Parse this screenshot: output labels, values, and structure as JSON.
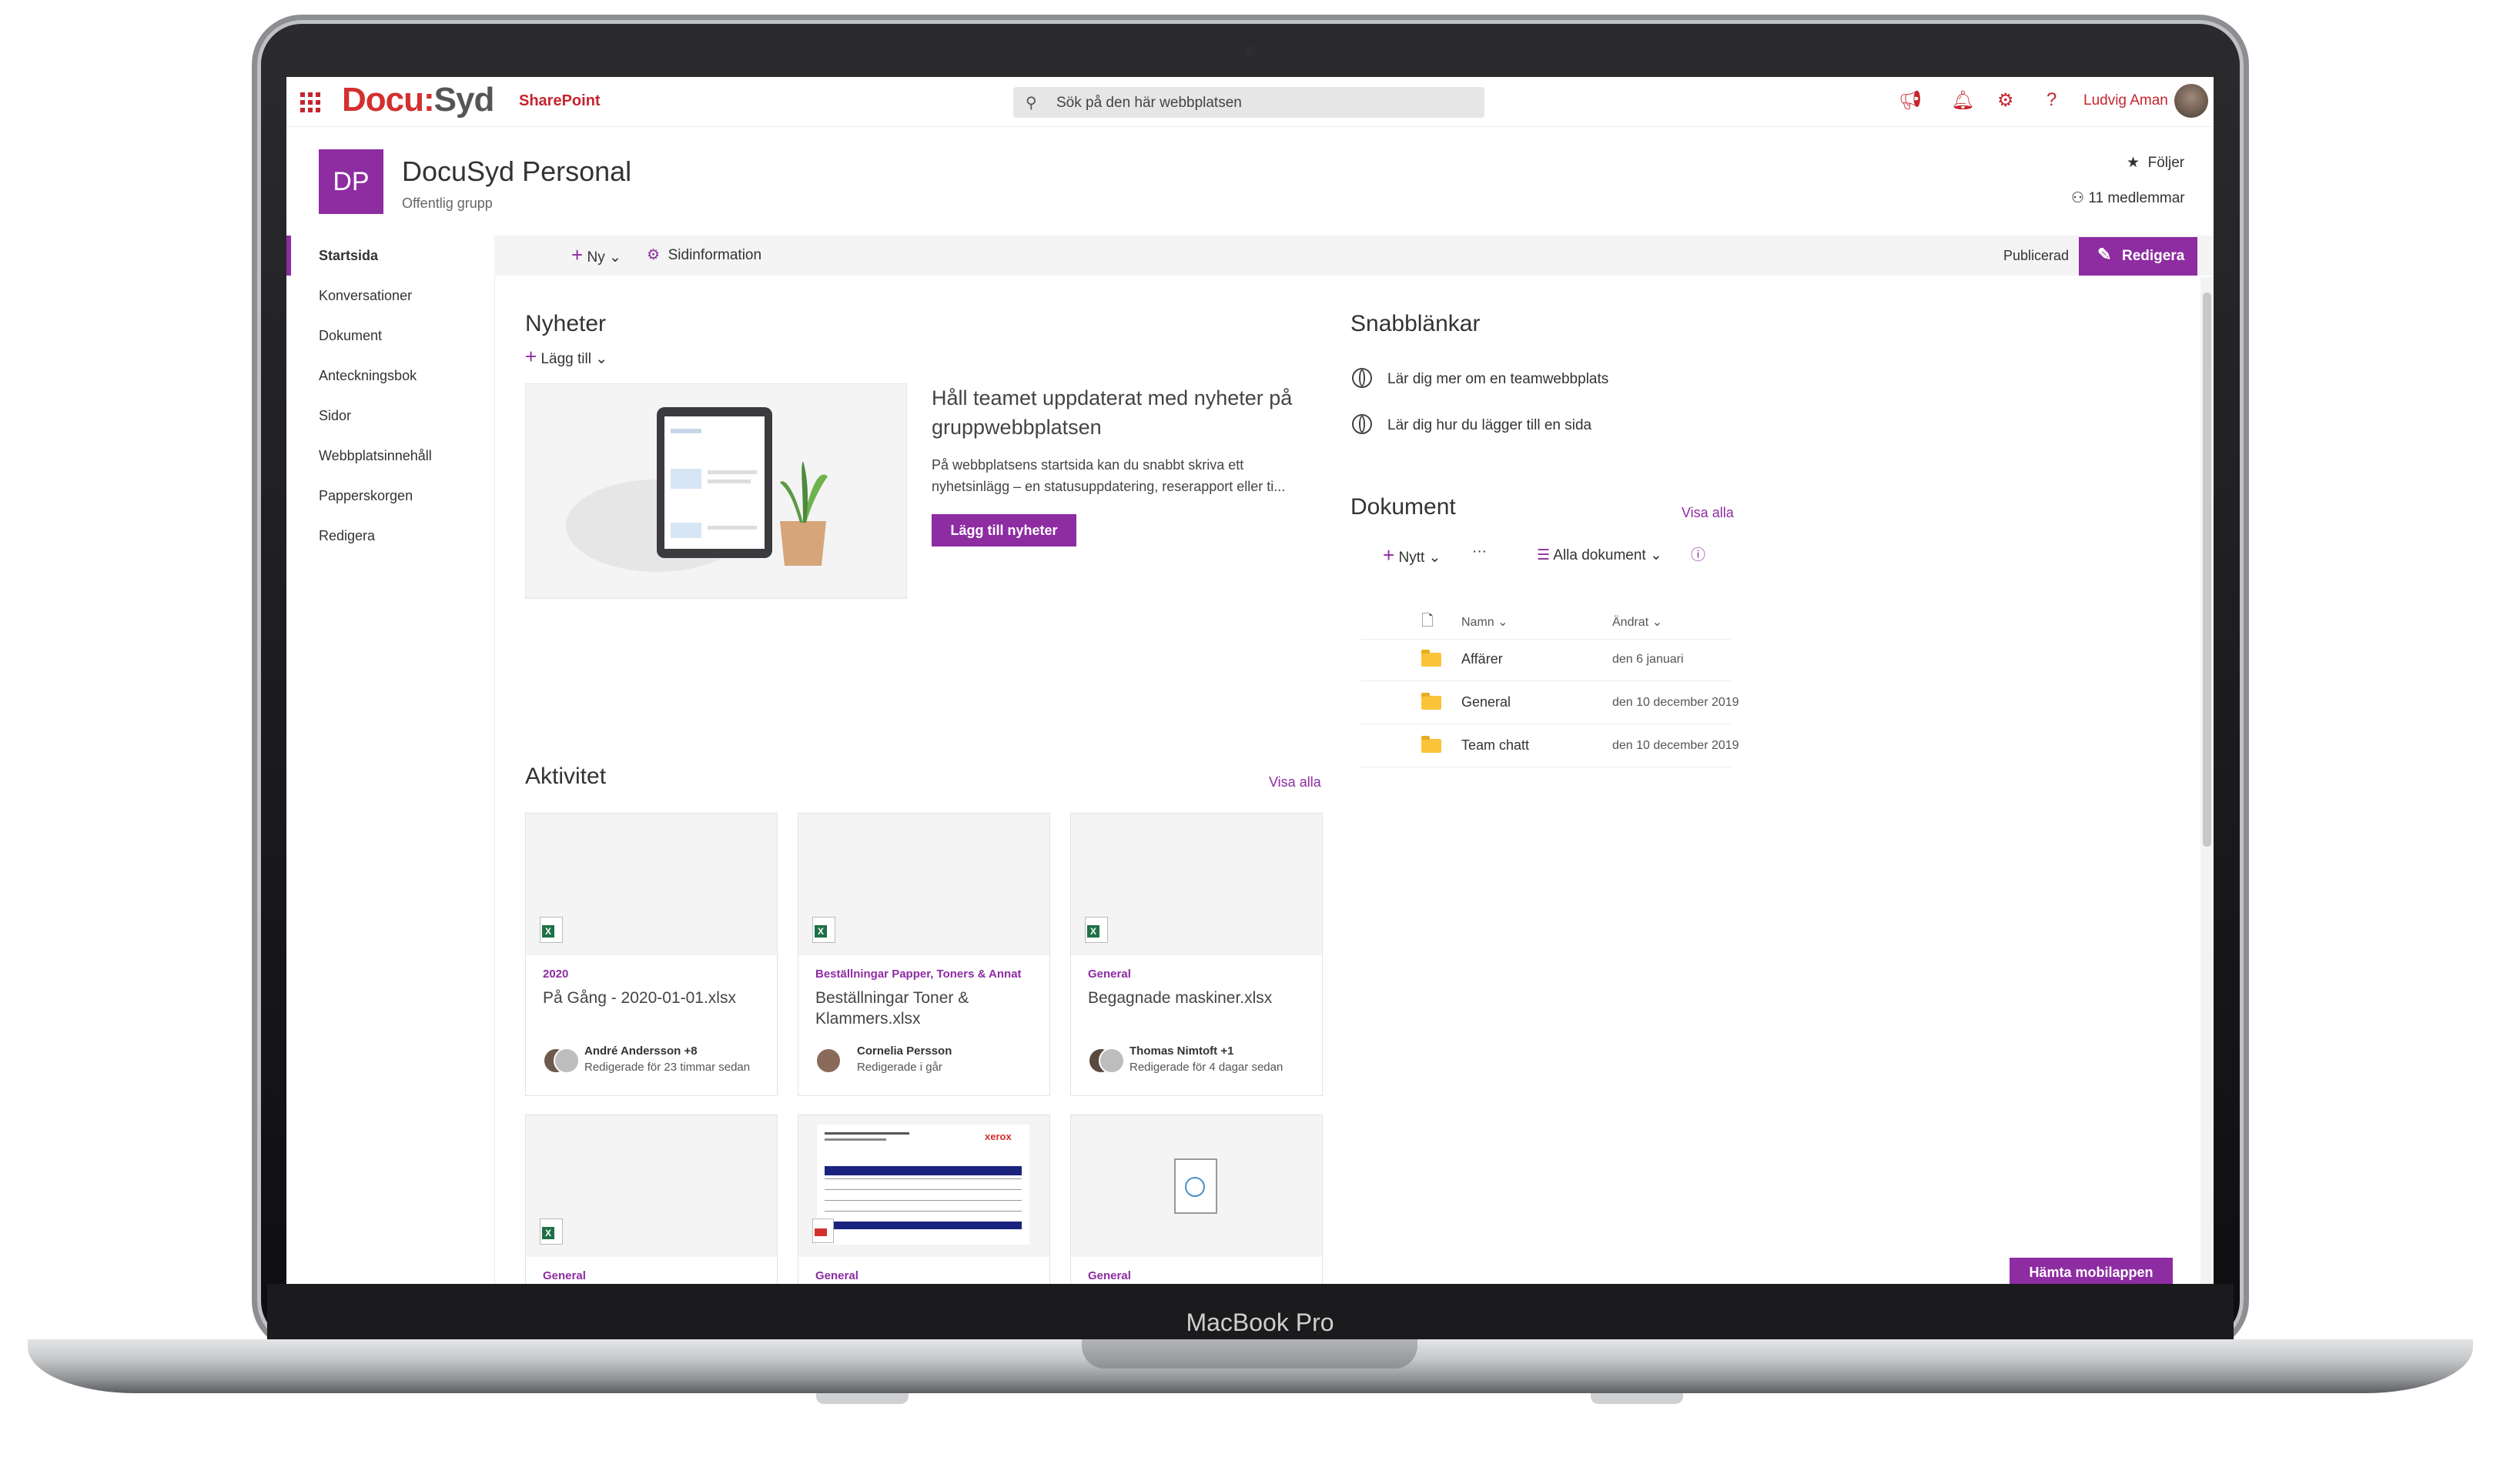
{
  "device": {
    "label": "MacBook Pro"
  },
  "suite": {
    "logo_docu": "Docu",
    "logo_colon": ":",
    "logo_syd": "Syd",
    "app_name": "SharePoint",
    "search_placeholder": "Sök på den här webbplatsen",
    "user_name": "Ludvig Aman"
  },
  "site": {
    "logo_initials": "DP",
    "title": "DocuSyd Personal",
    "subtitle": "Offentlig grupp",
    "follow_label": "Följer",
    "members_label": "11 medlemmar"
  },
  "nav": {
    "items": [
      "Startsida",
      "Konversationer",
      "Dokument",
      "Anteckningsbok",
      "Sidor",
      "Webbplatsinnehåll",
      "Papperskorgen",
      "Redigera"
    ]
  },
  "commandbar": {
    "new_label": "Ny",
    "page_info_label": "Sidinformation",
    "published_label": "Publicerad",
    "edit_label": "Redigera"
  },
  "news": {
    "title": "Nyheter",
    "add_label": "Lägg till",
    "headline": "Håll teamet uppdaterat med nyheter på gruppwebbplatsen",
    "body": "På webbplatsens startsida kan du snabbt skriva ett nyhetsinlägg – en statusuppdatering, reserapport eller ti...",
    "button_label": "Lägg till nyheter"
  },
  "quicklinks": {
    "title": "Snabblänkar",
    "items": [
      "Lär dig mer om en teamwebbplats",
      "Lär dig hur du lägger till en sida"
    ]
  },
  "documents": {
    "title": "Dokument",
    "see_all": "Visa alla",
    "new_label": "Nytt",
    "more_label": "···",
    "view_label": "Alla dokument",
    "col_name": "Namn",
    "col_modified": "Ändrat",
    "rows": [
      {
        "name": "Affärer",
        "date": "den 6 januari"
      },
      {
        "name": "General",
        "date": "den 10 december 2019"
      },
      {
        "name": "Team chatt",
        "date": "den 10 december 2019"
      }
    ]
  },
  "activity": {
    "title": "Aktivitet",
    "see_all": "Visa alla",
    "cards": [
      {
        "site": "2020",
        "title": "På Gång - 2020-01-01.xlsx",
        "author": "André Andersson +8",
        "time": "Redigerade för 23 timmar sedan"
      },
      {
        "site": "Beställningar Papper, Toners & Annat",
        "title": "Beställningar Toner & Klammers.xlsx",
        "author": "Cornelia Persson",
        "time": "Redigerade i går"
      },
      {
        "site": "General",
        "title": "Begagnade maskiner.xlsx",
        "author": "Thomas Nimtoft +1",
        "time": "Redigerade för 4 dagar sedan"
      },
      {
        "site": "General"
      },
      {
        "site": "General",
        "doc_brand": "xerox"
      },
      {
        "site": "General"
      }
    ]
  },
  "mobile": {
    "button_label": "Hämta mobilappen"
  },
  "colors": {
    "accent": "#8e2ca2",
    "brand_red": "#c4262e"
  }
}
